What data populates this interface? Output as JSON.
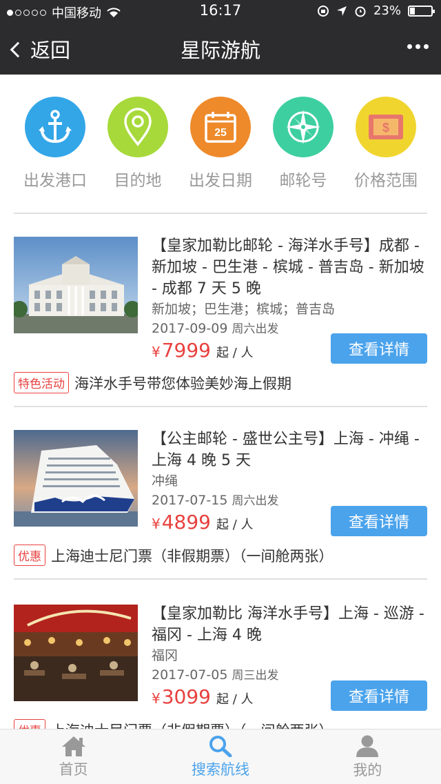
{
  "status_bar": {
    "carrier": "中国移动",
    "time": "16:17",
    "battery": "23%"
  },
  "navbar": {
    "back_label": "返回",
    "title": "星际游航"
  },
  "categories": [
    {
      "label": "出发港口",
      "icon": "anchor-icon",
      "color": "#33a6e8"
    },
    {
      "label": "目的地",
      "icon": "location-pin-icon",
      "color": "#a7d93a"
    },
    {
      "label": "出发日期",
      "icon": "calendar-icon",
      "color": "#ee8a2a",
      "calendar_day": "25"
    },
    {
      "label": "邮轮号",
      "icon": "compass-icon",
      "color": "#3ecfa0"
    },
    {
      "label": "价格范围",
      "icon": "money-icon",
      "color": "#f1d52f",
      "symbol": "$"
    }
  ],
  "cruises": [
    {
      "name": "【皇家加勒比邮轮 - 海洋水手号】成都 - 新加坡 - 巴生港 - 槟城 - 普吉岛 - 新加坡 - 成都 7 天 5 晚",
      "destinations": "新加坡；巴生港；槟城；普吉岛",
      "date": "2017-09-09",
      "weekday": "周六出发",
      "currency": "¥",
      "price": "7999",
      "price_unit": "起 / 人",
      "button": "查看详情",
      "tag": "特色活动",
      "promo": "海洋水手号带您体验美妙海上假期"
    },
    {
      "name": "【公主邮轮 - 盛世公主号】上海 - 冲绳 - 上海 4 晚 5 天",
      "destinations": "冲绳",
      "date": "2017-07-15",
      "weekday": "周六出发",
      "currency": "¥",
      "price": "4899",
      "price_unit": "起 / 人",
      "button": "查看详情",
      "tag": "优惠",
      "promo": "上海迪士尼门票（非假期票）（一间舱两张）"
    },
    {
      "name": "【皇家加勒比 海洋水手号】上海 - 巡游 - 福冈 - 上海 4 晚",
      "destinations": "福冈",
      "date": "2017-07-05",
      "weekday": "周三出发",
      "currency": "¥",
      "price": "3099",
      "price_unit": "起 / 人",
      "button": "查看详情",
      "tag": "优惠",
      "promo": "上海迪士尼门票（非假期票）（一间舱两张）"
    }
  ],
  "tabs": [
    {
      "label": "首页",
      "icon": "home-icon"
    },
    {
      "label": "搜索航线",
      "icon": "search-icon",
      "active": true
    },
    {
      "label": "我的",
      "icon": "user-icon"
    }
  ],
  "colors": {
    "price_red": "#e8413f",
    "button_blue": "#4ba3ec",
    "bar_dark": "#2c2c2e"
  }
}
